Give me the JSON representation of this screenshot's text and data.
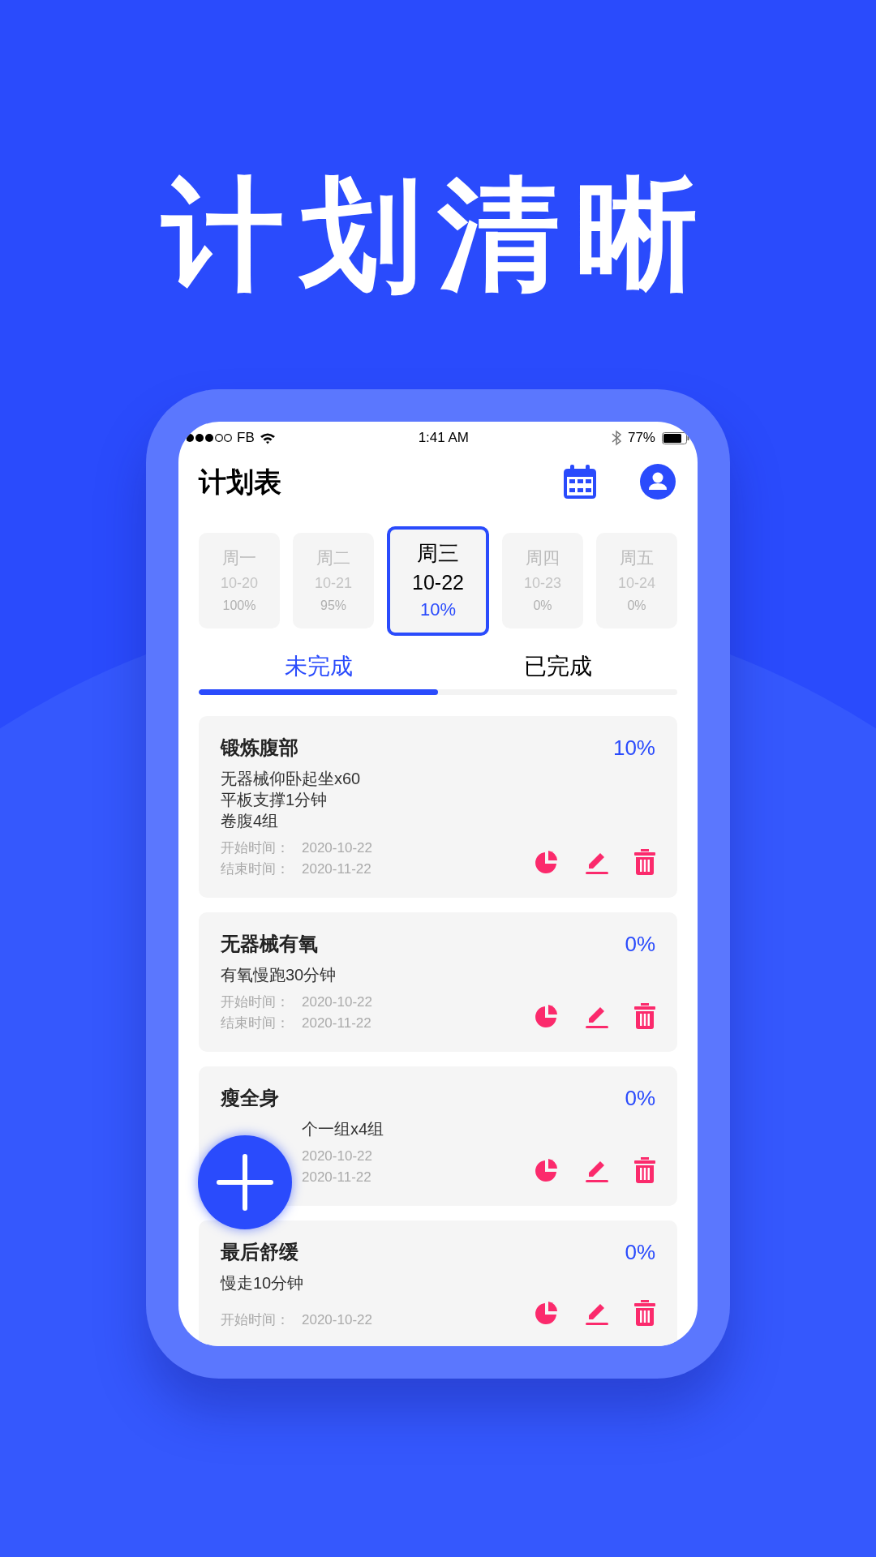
{
  "headline": "计划清晰",
  "status_bar": {
    "carrier": "FB",
    "time": "1:41 AM",
    "battery": "77%"
  },
  "header": {
    "title": "计划表"
  },
  "days": [
    {
      "day": "周一",
      "date": "10-20",
      "percent": "100%",
      "selected": false
    },
    {
      "day": "周二",
      "date": "10-21",
      "percent": "95%",
      "selected": false
    },
    {
      "day": "周三",
      "date": "10-22",
      "percent": "10%",
      "selected": true
    },
    {
      "day": "周四",
      "date": "10-23",
      "percent": "0%",
      "selected": false
    },
    {
      "day": "周五",
      "date": "10-24",
      "percent": "0%",
      "selected": false
    }
  ],
  "tabs": [
    {
      "label": "未完成",
      "selected": true
    },
    {
      "label": "已完成",
      "selected": false
    }
  ],
  "plans": [
    {
      "title": "锻炼腹部",
      "percent": "10%",
      "details": [
        "无器械仰卧起坐x60",
        "平板支撑1分钟",
        "卷腹4组"
      ],
      "start_label": "开始时间：",
      "start": "2020-10-22",
      "end_label": "结束时间：",
      "end": "2020-11-22"
    },
    {
      "title": "无器械有氧",
      "percent": "0%",
      "details": [
        "有氧慢跑30分钟"
      ],
      "start_label": "开始时间：",
      "start": "2020-10-22",
      "end_label": "结束时间：",
      "end": "2020-11-22"
    },
    {
      "title": "瘦全身",
      "percent": "0%",
      "details": [
        "个一组x4组"
      ],
      "start": "2020-10-22",
      "end": "2020-11-22"
    },
    {
      "title": "最后舒缓",
      "percent": "0%",
      "details": [
        "慢走10分钟"
      ],
      "start_label": "开始时间：",
      "start": "2020-10-22"
    }
  ]
}
